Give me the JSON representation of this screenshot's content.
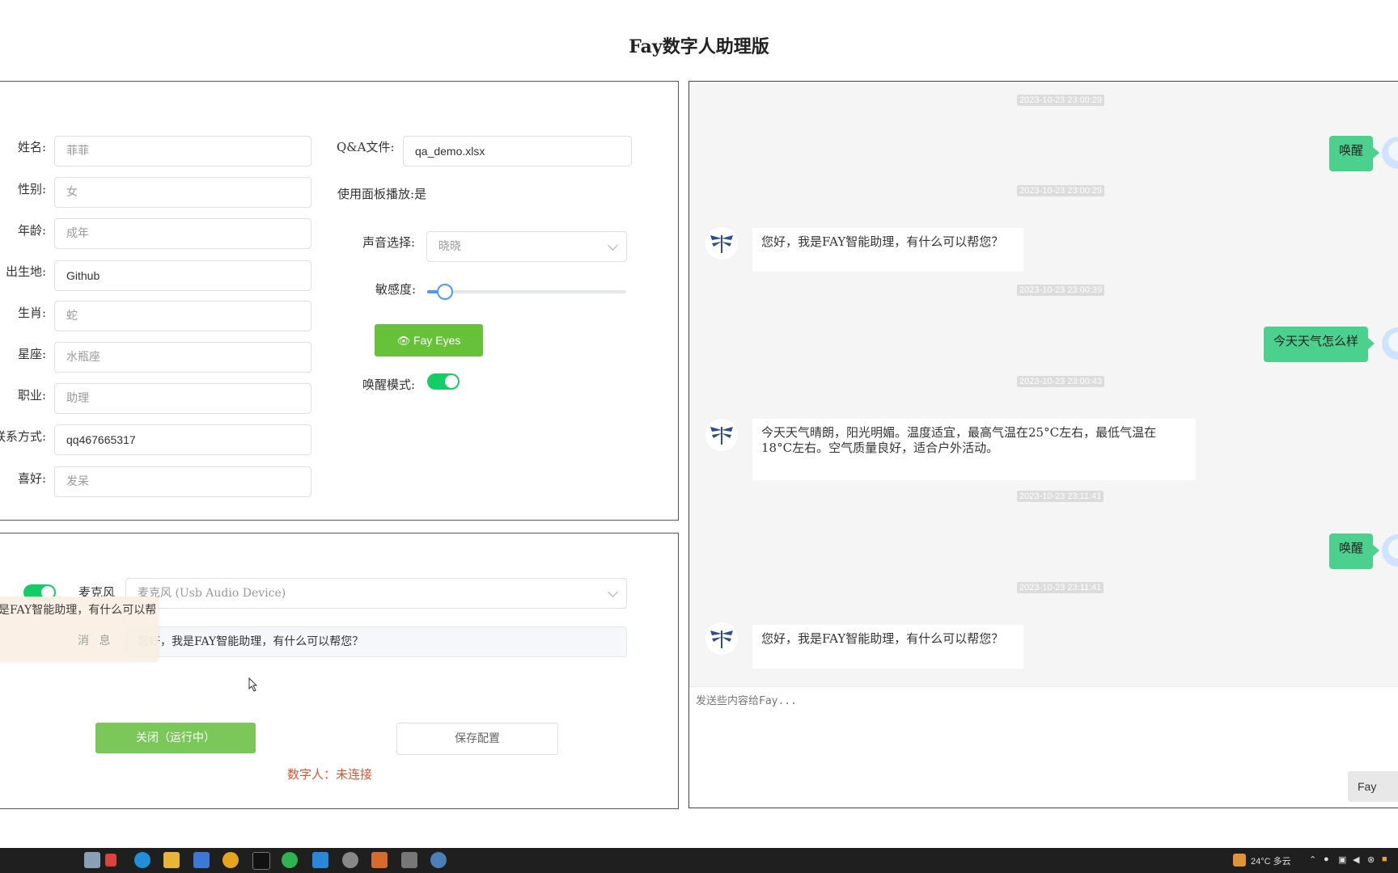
{
  "app": {
    "title": "Fay数字人助理版"
  },
  "profile": {
    "fields": [
      {
        "label": "姓名:",
        "value": "菲菲"
      },
      {
        "label": "性别:",
        "value": "女"
      },
      {
        "label": "年龄:",
        "value": "成年"
      },
      {
        "label": "出生地:",
        "value": "Github"
      },
      {
        "label": "生肖:",
        "value": "蛇"
      },
      {
        "label": "星座:",
        "value": "水瓶座"
      },
      {
        "label": "职业:",
        "value": "助理"
      },
      {
        "label": "联系方式:",
        "value": "qq467665317"
      },
      {
        "label": "喜好:",
        "value": "发呆"
      }
    ],
    "qa_label": "Q&A文件:",
    "qa_value": "qa_demo.xlsx",
    "panel_play_label": "使用面板播放:",
    "panel_play_value": "是",
    "voice_label": "声音选择:",
    "voice_value": "晓晓",
    "sensitivity_label": "敏感度:",
    "sensitivity_value": 0.05,
    "fay_eyes_label": "Fay Eyes",
    "wake_mode_label": "唤醒模式:",
    "wake_mode_on": true
  },
  "control": {
    "mic_toggle_on": true,
    "mic_label": "麦克风",
    "mic_value": "麦克风 (Usb Audio Device)",
    "message_value": "您好，我是FAY智能助理，有什么可以帮您？",
    "close_button": "关闭（运行中）",
    "save_button": "保存配置",
    "status": "数字人：未连接"
  },
  "toast": {
    "text": "是FAY智能助理，有什么可以帮",
    "title": "消 息"
  },
  "chat": {
    "timestamps": [
      "2023-10-23 23:00:29",
      "2023-10-23 23:00:29",
      "2023-10-23 23:00:39",
      "2023-10-23 23:00:43",
      "2023-10-23 23:11:41",
      "2023-10-23 23:11:41"
    ],
    "messages": [
      "唤醒",
      "您好，我是FAY智能助理，有什么可以帮您？",
      "今天天气怎么样",
      "今天天气晴朗，阳光明媚。温度适宜，最高气温在25°C左右，最低气温在18°C左右。空气质量良好，适合户外活动。",
      "唤醒",
      "您好，我是FAY智能助理，有什么可以帮您？"
    ],
    "input_placeholder": "发送些内容给Fay...",
    "send_label": "Fay"
  },
  "taskbar": {
    "weather": "24°C 多云"
  },
  "colors": {
    "accent_green": "#67c23a",
    "toggle_green": "#13ce66",
    "bubble_green": "#4cd08d",
    "slider_blue": "#409eff",
    "status_red": "#e0532f"
  }
}
